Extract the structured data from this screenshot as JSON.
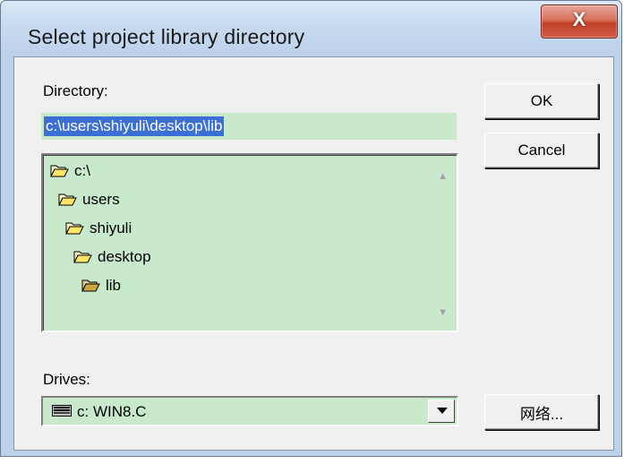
{
  "window": {
    "title": "Select project library directory"
  },
  "close_button": {
    "label": "X"
  },
  "directory": {
    "label": "Directory:",
    "path_value": "c:\\users\\shiyuli\\desktop\\lib",
    "tree": [
      {
        "name": "c:\\",
        "open": true
      },
      {
        "name": "users",
        "open": true
      },
      {
        "name": "shiyuli",
        "open": true
      },
      {
        "name": "desktop",
        "open": true
      },
      {
        "name": "lib",
        "open": true,
        "selected": true
      }
    ]
  },
  "drives": {
    "label": "Drives:",
    "selected": "c: WIN8.C"
  },
  "buttons": {
    "ok": "OK",
    "cancel": "Cancel",
    "network": "网络..."
  },
  "colors": {
    "field_bg": "#c8e9cc",
    "selection": "#3b6fd6",
    "close_red": "#c2412a"
  },
  "icons": {
    "folder": "open-folder-icon",
    "drive": "hard-drive-icon"
  }
}
